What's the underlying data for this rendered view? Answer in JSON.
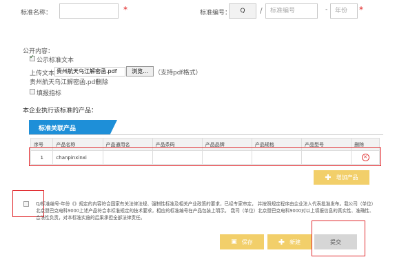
{
  "fields": {
    "name_label": "标准名称：",
    "name_value": "",
    "required_mark": "*",
    "code_label": "标准编号：",
    "code_prefix": "Q",
    "code_slash": "/",
    "code_placeholder": "标准编号",
    "code_dash": "-",
    "year_placeholder": "年份"
  },
  "public": {
    "title": "公开内容：",
    "publish_text_label": "公示标准文本",
    "upload_label": "上传文本：",
    "upload_file_value": "贵州航天乌江解密函.pdf",
    "browse_button": "浏览...",
    "pdf_hint": "（支持pdf格式）",
    "uploaded_filename": "贵州航天乌江解密函.pdf",
    "delete_link": "删除",
    "fill_indicator_label": "填报指标"
  },
  "products": {
    "section_title": "本企业执行该标准的产品：",
    "tab_title": "标准关联产品",
    "columns": [
      "序号",
      "产品名称",
      "产品通用名",
      "产品条码",
      "产品品牌",
      "产品规格",
      "产品型号",
      "删除"
    ],
    "rows": [
      {
        "index": "1",
        "name": "chanpinxinxi",
        "generic": "",
        "barcode": "",
        "brand": "",
        "spec": "",
        "model": ""
      }
    ],
    "add_button": "增加产品"
  },
  "declaration": {
    "text": "Q/标准编号-年份《》规定的内容符合国家有关法律法规、强制性标准及相关产业政策的要求，已经专家审定， 并按照规定程序由企业法人代表批准发布。我公司（单位）北京盟巴克电科9000上述产品符合本标准规定的技术要求，相应的标准编号在产品包装上明示。 我司（单位）北京盟巴克电科9000对以上填报信息的真实性、准确性、合法性负责，对本标准实施的后果承担全部法律责任。"
  },
  "actions": {
    "save": "保存",
    "new": "新建",
    "submit": "提交"
  },
  "colors": {
    "tab_blue": "#1e8fd8",
    "required_red": "#e02020",
    "highlight_red": "#e0262a",
    "button_yellow": "#f2cf6a"
  }
}
